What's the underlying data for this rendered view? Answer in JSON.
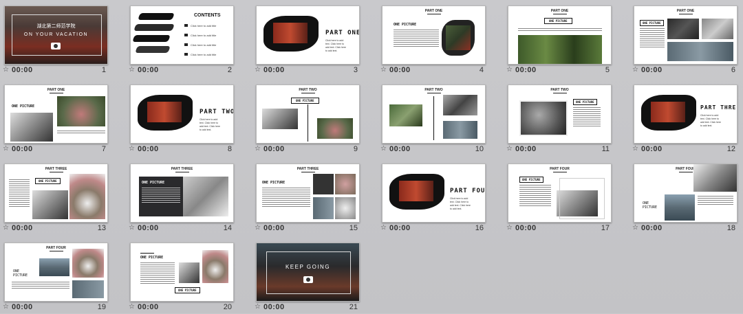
{
  "thumbnail_time": "00:00",
  "slides": [
    {
      "number": "1",
      "title": "湖北第二师范学院",
      "subtitle": "ON YOUR VACATION"
    },
    {
      "number": "2",
      "title": "CONTENTS",
      "items": [
        "Click here to add title",
        "Click here to add title",
        "Click here to add title",
        "Click here to add title"
      ]
    },
    {
      "number": "3",
      "title": "PART ONE"
    },
    {
      "number": "4",
      "header": "PART ONE",
      "label": "ONE PICTURE"
    },
    {
      "number": "5",
      "header": "PART ONE",
      "label": "ONE PICTURE"
    },
    {
      "number": "6",
      "header": "PART ONE",
      "label": "ONE PICTURE"
    },
    {
      "number": "7",
      "header": "PART ONE",
      "label": "ONE PICTURE"
    },
    {
      "number": "8",
      "title": "PART TWO"
    },
    {
      "number": "9",
      "header": "PART TWO",
      "label": "ONE PICTURE"
    },
    {
      "number": "10",
      "header": "PART TWO"
    },
    {
      "number": "11",
      "header": "PART TWO",
      "label": "ONE PICTURE"
    },
    {
      "number": "12",
      "title": "PART THREE"
    },
    {
      "number": "13",
      "header": "PART THREE",
      "label": "ONE PICTURE"
    },
    {
      "number": "14",
      "header": "PART THREE",
      "label": "ONE PICTURE"
    },
    {
      "number": "15",
      "header": "PART THREE",
      "label": "ONE PICTURE"
    },
    {
      "number": "16",
      "title": "PART FOUR"
    },
    {
      "number": "17",
      "header": "PART FOUR",
      "label": "ONE PICTURE"
    },
    {
      "number": "18",
      "header": "PART FOUR",
      "label": "ONE PICTURE"
    },
    {
      "number": "19",
      "header": "PART FOUR",
      "label": "ONE PICTURE"
    },
    {
      "number": "20",
      "header": "PART FOUR",
      "label": "ONE PICTURE"
    },
    {
      "number": "21",
      "title": "KEEP GOING"
    }
  ],
  "part_blurb": "Click here to add text. Click here to add text. Click here to add text."
}
